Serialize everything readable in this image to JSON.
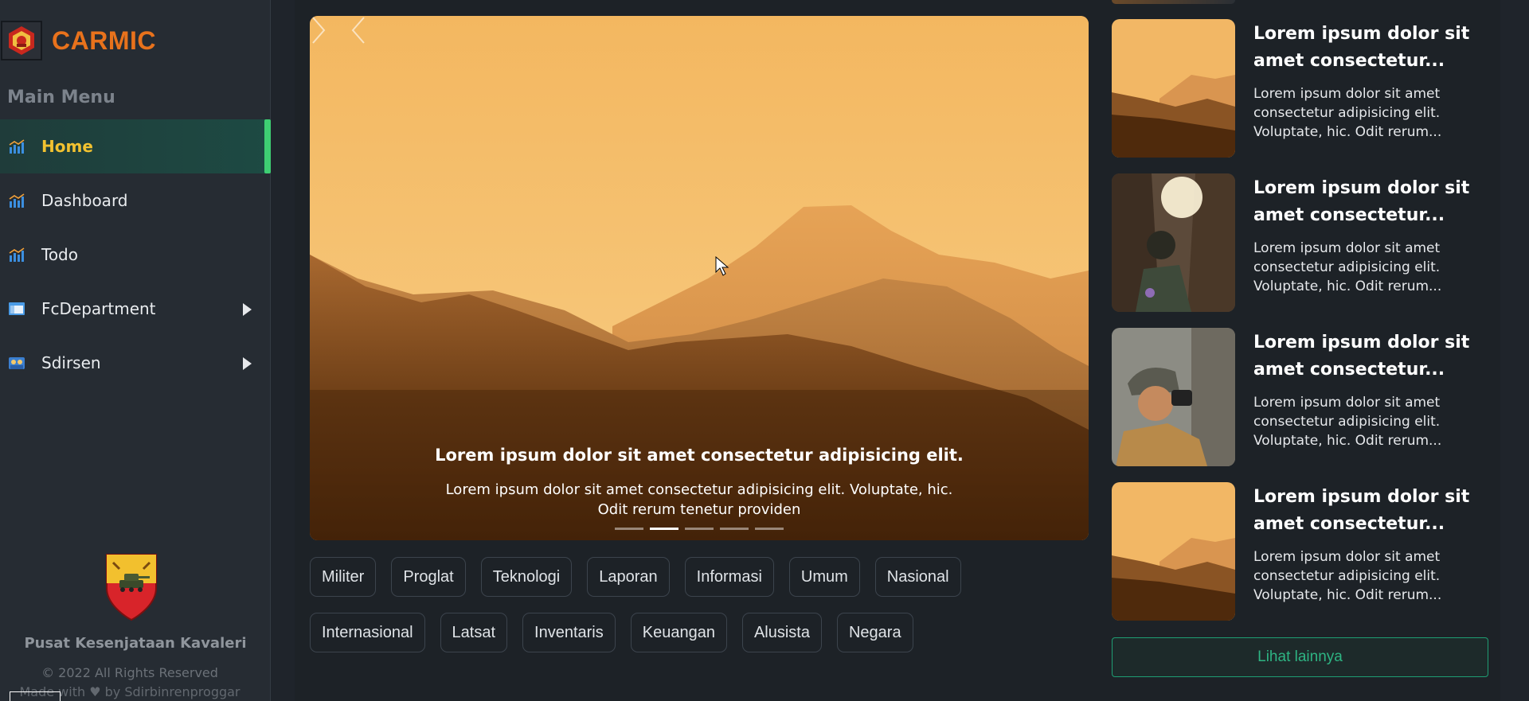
{
  "sidebar": {
    "brand": "CARMIC",
    "menu_title": "Main Menu",
    "items": [
      {
        "label": "Home",
        "icon": "chart-bar-icon"
      },
      {
        "label": "Dashboard",
        "icon": "chart-bar-icon"
      },
      {
        "label": "Todo",
        "icon": "chart-bar-icon"
      },
      {
        "label": "FcDepartment",
        "icon": "window-icon"
      },
      {
        "label": "Sdirsen",
        "icon": "people-icon"
      }
    ],
    "footer": {
      "org": "Pusat Kesenjataan Kavaleri",
      "copyright": "© 2022 All Rights Reserved",
      "made_with": "Made with ♥ by Sdirbinrenproggar"
    }
  },
  "hero": {
    "title": "Lorem ipsum dolor sit amet consectetur adipisicing elit.",
    "text": "Lorem ipsum dolor sit amet consectetur adipisicing elit. Voluptate, hic. Odit rerum tenetur providen",
    "slide_count": 5,
    "active_slide": 2
  },
  "tags": {
    "row1": [
      "Militer",
      "Proglat",
      "Teknologi",
      "Laporan",
      "Informasi",
      "Umum",
      "Nasional"
    ],
    "row2": [
      "Internasional",
      "Latsat",
      "Inventaris",
      "Keuangan",
      "Alusista",
      "Negara"
    ]
  },
  "news": [
    {
      "title": "Lorem ipsum dolor sit amet consectetur...",
      "text": "Lorem ipsum dolor sit amet consectetur adipisicing elit. Voluptate, hic. Odit rerum..."
    },
    {
      "title": "Lorem ipsum dolor sit amet consectetur...",
      "text": "Lorem ipsum dolor sit amet consectetur adipisicing elit. Voluptate, hic. Odit rerum..."
    },
    {
      "title": "Lorem ipsum dolor sit amet consectetur...",
      "text": "Lorem ipsum dolor sit amet consectetur adipisicing elit. Voluptate, hic. Odit rerum..."
    },
    {
      "title": "Lorem ipsum dolor sit amet consectetur...",
      "text": "Lorem ipsum dolor sit amet consectetur adipisicing elit. Voluptate, hic. Odit rerum..."
    }
  ],
  "more_button": "Lihat lainnya",
  "colors": {
    "brand": "#e8721c",
    "active_menu": "#f2c230",
    "accent_green": "#3ecf73",
    "button_green": "#2eb483"
  }
}
